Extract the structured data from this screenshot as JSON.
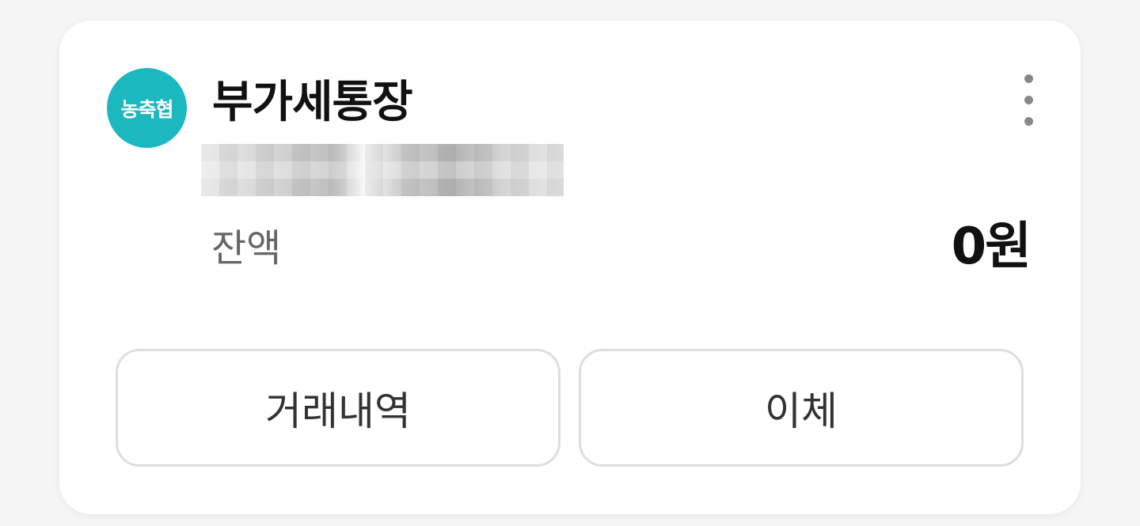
{
  "account": {
    "bank_logo_text": "농축협",
    "bank_color": "#1cb8bf",
    "name": "부가세통장",
    "more_icon": "more-vertical-icon"
  },
  "balance": {
    "label": "잔액",
    "value": "0원"
  },
  "actions": {
    "history_label": "거래내역",
    "transfer_label": "이체"
  }
}
